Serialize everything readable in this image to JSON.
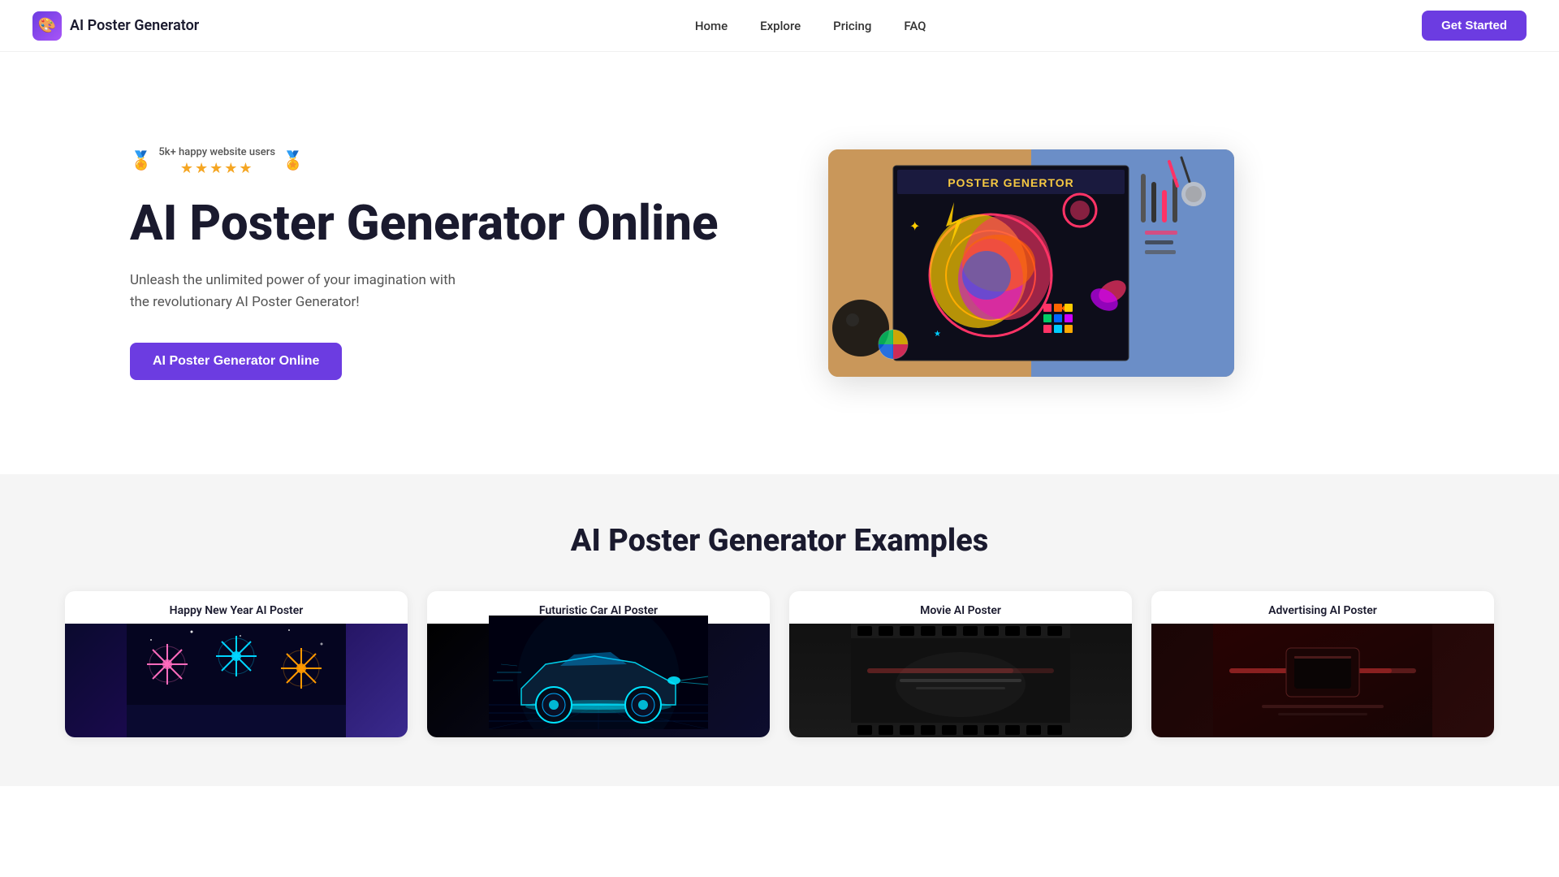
{
  "navbar": {
    "logo_icon": "🎨",
    "logo_text": "AI Poster Generator",
    "links": [
      {
        "label": "Home",
        "href": "#"
      },
      {
        "label": "Explore",
        "href": "#"
      },
      {
        "label": "Pricing",
        "href": "#"
      },
      {
        "label": "FAQ",
        "href": "#"
      }
    ],
    "cta_label": "Get Started"
  },
  "hero": {
    "badge_text": "5k+ happy website users",
    "stars": "★★★★★",
    "title": "AI Poster Generator Online",
    "subtitle": "Unleash the unlimited power of your imagination with the revolutionary AI Poster Generator!",
    "cta_label": "AI Poster Generator Online"
  },
  "examples": {
    "section_title": "AI Poster Generator Examples",
    "cards": [
      {
        "title": "Happy New Year AI Poster",
        "type": "new-year"
      },
      {
        "title": "Futuristic Car AI Poster",
        "type": "car"
      },
      {
        "title": "Movie AI Poster",
        "type": "movie"
      },
      {
        "title": "Advertising AI Poster",
        "type": "ad"
      }
    ]
  }
}
